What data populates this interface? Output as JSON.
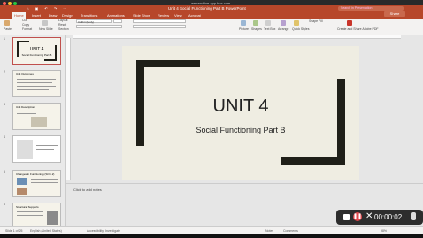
{
  "browser": {
    "url": "webarchive.app.box.com"
  },
  "window": {
    "title": "Unit 4 Social Functioning Part B PowerPoint",
    "search_placeholder": "Search in Presentation",
    "share_label": "Share"
  },
  "menu": {
    "tabs": [
      "Home",
      "Insert",
      "Draw",
      "Design",
      "Transitions",
      "Animations",
      "Slide Show",
      "Review",
      "View",
      "Acrobat"
    ]
  },
  "ribbon": {
    "paste": "Paste",
    "cut": "Cut",
    "copy": "Copy",
    "format": "Format",
    "new_slide": "New Slide",
    "layout": "Layout",
    "reset": "Reset",
    "section": "Section",
    "font_name": "Calibri (Body)",
    "picture": "Picture",
    "shapes": "Shapes",
    "text_box": "Text Box",
    "arrange": "Arrange",
    "quick_styles": "Quick Styles",
    "shape_fill": "Shape Fill",
    "create_share": "Create and Share Adobe PDF"
  },
  "thumbnails": [
    {
      "num": "1",
      "title": "UNIT 4",
      "subtitle": "Social Functioning Part B"
    },
    {
      "num": "2",
      "title": "Unit Outcomes"
    },
    {
      "num": "3",
      "title": "Unit Description"
    },
    {
      "num": "4",
      "title": ""
    },
    {
      "num": "5",
      "title": "Changes in Functioning (SOC.2)"
    },
    {
      "num": "6",
      "title": "Structural Supports"
    }
  ],
  "slide": {
    "title": "UNIT 4",
    "subtitle": "Social Functioning Part B"
  },
  "notes": {
    "placeholder": "Click to add notes"
  },
  "status": {
    "slide_count": "Slide 1 of 25",
    "language": "English (United States)",
    "accessibility": "Accessibility: Investigate",
    "notes": "Notes",
    "comments": "Comments",
    "zoom": "98%"
  },
  "recorder": {
    "time": "00:00:02"
  },
  "colors": {
    "accent": "#b7472a",
    "slide_bg": "#efede2",
    "frame": "#1f1f18"
  }
}
